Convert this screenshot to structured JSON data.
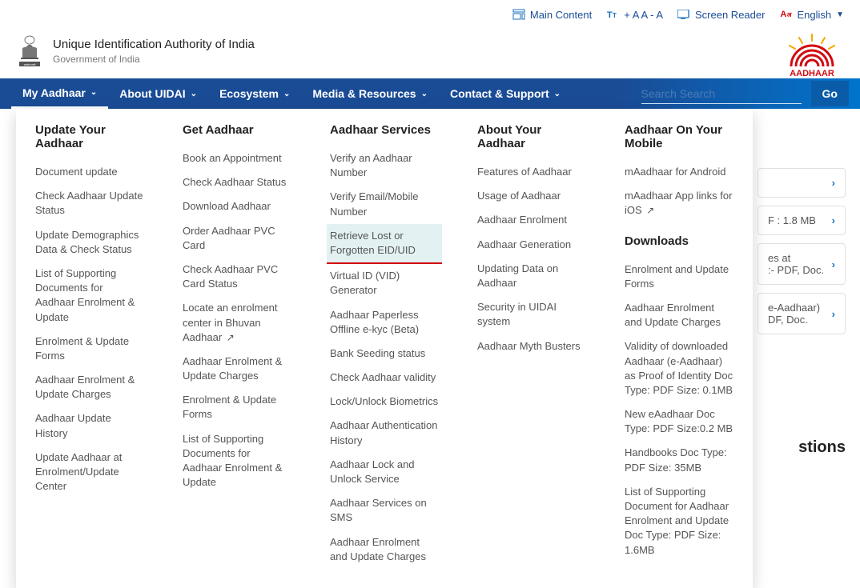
{
  "topbar": {
    "main_content": "Main Content",
    "text_size": "+ A A - A",
    "screen_reader": "Screen Reader",
    "language": "English"
  },
  "header": {
    "title": "Unique Identification Authority of India",
    "subtitle": "Government of India",
    "logo_label": "AADHAAR"
  },
  "nav": {
    "items": [
      "My Aadhaar",
      "About UIDAI",
      "Ecosystem",
      "Media & Resources",
      "Contact & Support"
    ],
    "search_placeholder": "Search Search",
    "go": "Go"
  },
  "mega": {
    "col1": {
      "title": "Update Your Aadhaar",
      "links": [
        "Document update",
        "Check Aadhaar Update Status",
        "Update Demographics Data & Check Status",
        "List of Supporting Documents for Aadhaar Enrolment & Update",
        "Enrolment & Update Forms",
        "Aadhaar Enrolment & Update Charges",
        "Aadhaar Update History",
        "Update Aadhaar at Enrolment/Update Center"
      ]
    },
    "col2": {
      "title": "Get Aadhaar",
      "links": [
        "Book an Appointment",
        "Check Aadhaar Status",
        "Download Aadhaar",
        "Order Aadhaar PVC Card",
        "Check Aadhaar PVC Card Status",
        "Locate an enrolment center in Bhuvan Aadhaar",
        "Aadhaar Enrolment & Update Charges",
        "Enrolment & Update Forms",
        "List of Supporting Documents for Aadhaar Enrolment & Update"
      ]
    },
    "col3": {
      "title": "Aadhaar Services",
      "links": [
        "Verify an Aadhaar Number",
        "Verify Email/Mobile Number",
        "Retrieve Lost or Forgotten EID/UID",
        "Virtual ID (VID) Generator",
        "Aadhaar Paperless Offline e-kyc (Beta)",
        "Bank Seeding status",
        "Check Aadhaar validity",
        "Lock/Unlock Biometrics",
        "Aadhaar Authentication History",
        "Aadhaar Lock and Unlock Service",
        "Aadhaar Services on SMS",
        "Aadhaar Enrolment and Update Charges"
      ]
    },
    "col4": {
      "title": "About Your Aadhaar",
      "links": [
        "Features of Aadhaar",
        "Usage of Aadhaar",
        "Aadhaar Enrolment",
        "Aadhaar Generation",
        "Updating Data on Aadhaar",
        "Security in UIDAI system",
        "Aadhaar Myth Busters"
      ]
    },
    "col5": {
      "title": "Aadhaar On Your Mobile",
      "links_top": [
        "mAadhaar for Android",
        "mAadhaar App links for iOS"
      ],
      "downloads_title": "Downloads",
      "downloads": [
        "Enrolment and Update Forms",
        "Aadhaar Enrolment and Update Charges",
        "Validity of downloaded Aadhaar (e-Aadhaar) as Proof of Identity Doc Type: PDF Size: 0.1MB",
        "New eAadhaar Doc Type: PDF Size:0.2 MB",
        "Handbooks Doc Type: PDF Size: 35MB",
        "List of Supporting Document for Aadhaar Enrolment and Update Doc Type: PDF Size: 1.6MB"
      ]
    }
  },
  "bg_cards": [
    "F : 1.8 MB",
    "es at\n:- PDF, Doc.",
    "e-Aadhaar)\nDF, Doc."
  ],
  "bg_card_top": "",
  "faq_title": "stions"
}
